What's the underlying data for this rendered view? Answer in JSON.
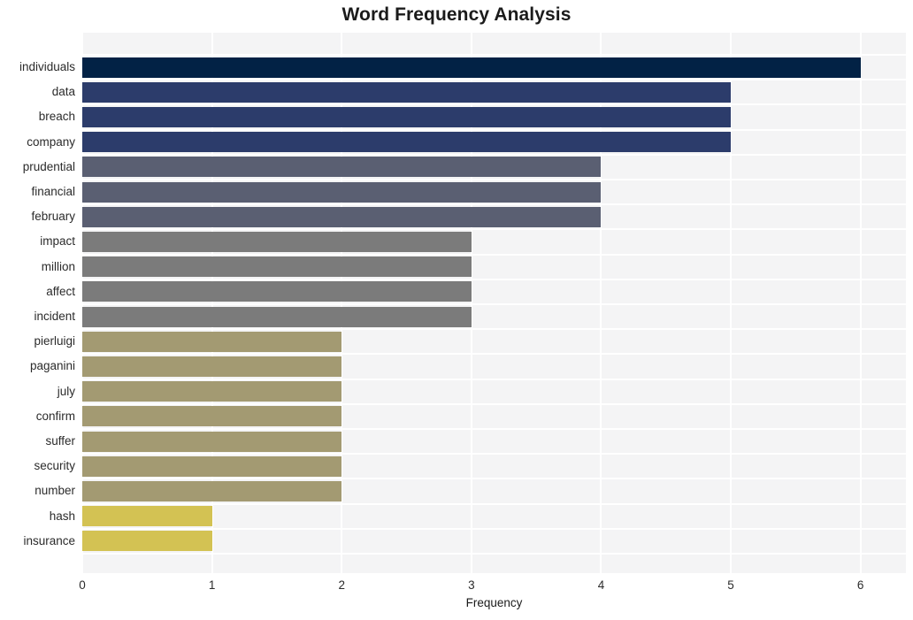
{
  "chart_data": {
    "type": "bar",
    "orientation": "horizontal",
    "title": "Word Frequency Analysis",
    "xlabel": "Frequency",
    "ylabel": "",
    "xlim": [
      0,
      6.35
    ],
    "xticks": [
      0,
      1,
      2,
      3,
      4,
      5,
      6
    ],
    "xtick_labels": [
      "0",
      "1",
      "2",
      "3",
      "4",
      "5",
      "6"
    ],
    "grid": true,
    "legend": "none",
    "categories": [
      "individuals",
      "data",
      "breach",
      "company",
      "prudential",
      "financial",
      "february",
      "impact",
      "million",
      "affect",
      "incident",
      "pierluigi",
      "paganini",
      "july",
      "confirm",
      "suffer",
      "security",
      "number",
      "hash",
      "insurance"
    ],
    "values": [
      6,
      5,
      5,
      5,
      4,
      4,
      4,
      3,
      3,
      3,
      3,
      2,
      2,
      2,
      2,
      2,
      2,
      2,
      1,
      1
    ],
    "bar_colors": [
      "#022245",
      "#2c3c6b",
      "#2c3c6b",
      "#2c3c6b",
      "#5a5f72",
      "#5a5f72",
      "#5a5f72",
      "#7b7b7b",
      "#7b7b7b",
      "#7b7b7b",
      "#7b7b7b",
      "#a39a72",
      "#a39a72",
      "#a39a72",
      "#a39a72",
      "#a39a72",
      "#a39a72",
      "#a39a72",
      "#d3c253",
      "#d3c253"
    ],
    "plot_background": "#f4f4f5",
    "grid_color": "#ffffff",
    "figure_background": "#ffffff",
    "text_color": "#2b2b2b"
  }
}
